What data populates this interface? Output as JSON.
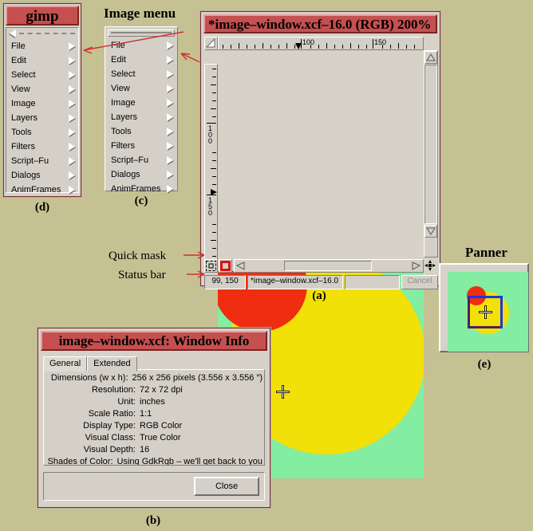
{
  "page": {
    "background_color": "#c5c193",
    "titlebar_color": "#c4504f",
    "frame_color": "#7a2e2e",
    "canvas_bg_color": "#83eda2",
    "yellow_color": "#f2e009",
    "red_color": "#ef2d10"
  },
  "toolbox_menu": {
    "title": "gimp",
    "fig_label": "(d)",
    "items": [
      {
        "label": "File"
      },
      {
        "label": "Edit"
      },
      {
        "label": "Select"
      },
      {
        "label": "View"
      },
      {
        "label": "Image"
      },
      {
        "label": "Layers"
      },
      {
        "label": "Tools"
      },
      {
        "label": "Filters"
      },
      {
        "label": "Script–Fu"
      },
      {
        "label": "Dialogs"
      },
      {
        "label": "AnimFrames"
      }
    ]
  },
  "image_menu": {
    "heading": "Image menu",
    "fig_label": "(c)",
    "items": [
      {
        "label": "File"
      },
      {
        "label": "Edit"
      },
      {
        "label": "Select"
      },
      {
        "label": "View"
      },
      {
        "label": "Image"
      },
      {
        "label": "Layers"
      },
      {
        "label": "Tools"
      },
      {
        "label": "Filters"
      },
      {
        "label": "Script–Fu"
      },
      {
        "label": "Dialogs"
      },
      {
        "label": "AnimFrames"
      }
    ]
  },
  "image_window": {
    "title": "*image–window.xcf–16.0 (RGB) 200%",
    "fig_label": "(a)",
    "ruler_h_labels": [
      "100",
      "150"
    ],
    "ruler_v_labels": [
      "100",
      "150"
    ],
    "status": {
      "position": "99, 150",
      "filename": "*image–window.xcf–16.0",
      "progress": "",
      "cancel_label": "Cancel"
    }
  },
  "callouts": {
    "quick_mask": "Quick mask",
    "status_bar": "Status bar"
  },
  "panner": {
    "heading": "Panner",
    "fig_label": "(e)"
  },
  "window_info": {
    "title": "image–window.xcf: Window Info",
    "fig_label": "(b)",
    "tabs": [
      {
        "label": "General",
        "selected": true
      },
      {
        "label": "Extended",
        "selected": false
      }
    ],
    "rows": [
      {
        "key": "Dimensions (w x h):",
        "value": "256 x 256 pixels (3.556 x 3.556 ″)"
      },
      {
        "key": "Resolution:",
        "value": "72 x 72 dpi"
      },
      {
        "key": "Unit:",
        "value": "inches"
      },
      {
        "key": "Scale Ratio:",
        "value": "1:1"
      },
      {
        "key": "Display Type:",
        "value": "RGB Color"
      },
      {
        "key": "Visual Class:",
        "value": "True Color"
      },
      {
        "key": "Visual Depth:",
        "value": "16"
      },
      {
        "key": "Shades of Color:",
        "value": "Using GdkRgb – we'll get back to you"
      }
    ],
    "close_label": "Close"
  }
}
